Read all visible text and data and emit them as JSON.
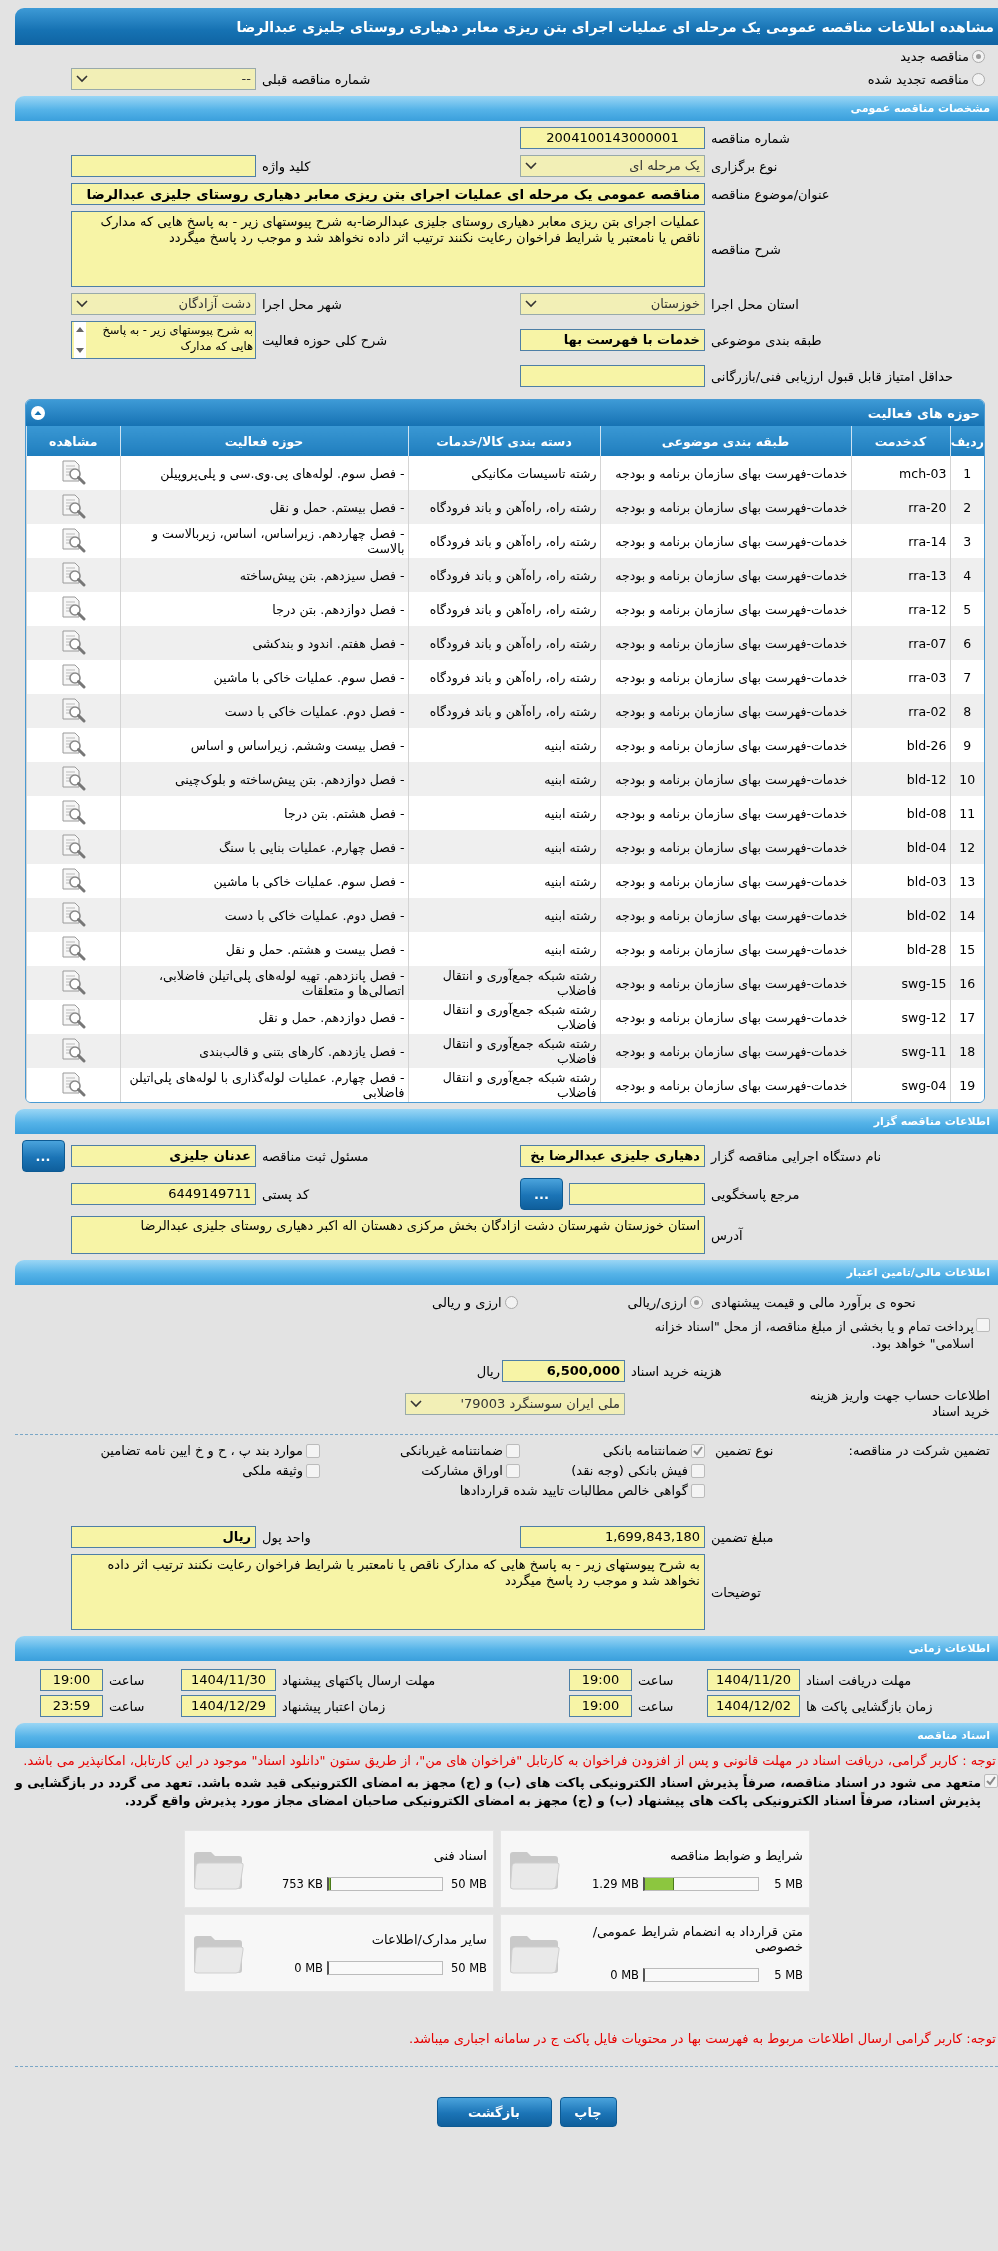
{
  "window": {
    "title": "مشاهده اطلاعات مناقصه عمومی یک مرحله ای عملیات اجرای بتن ریزی معابر دهیاری روستای جلیزی عبدالرضا"
  },
  "tender_type": {
    "options": [
      {
        "label": "مناقصه جدید",
        "selected": true
      },
      {
        "label": "مناقصه تجدید شده",
        "selected": false
      }
    ],
    "previous_tender": {
      "label": "شماره مناقصه قبلی",
      "kind": "select",
      "value": "--"
    }
  },
  "general": {
    "header": "مشخصات مناقصه عمومی",
    "rows": [
      [
        {
          "label": "شماره مناقصه",
          "kind": "id",
          "value": "2004100143000001"
        }
      ],
      [
        {
          "label": "نوع برگزاری",
          "kind": "select",
          "value": "یک مرحله ای"
        },
        {
          "label": "کلید واژه",
          "kind": "text"
        }
      ],
      [
        {
          "label": "عنوان/موضوع مناقصه",
          "kind": "title",
          "value": "مناقصه عمومی یک مرحله ای عملیات اجرای بتن ریزی معابر دهیاری روستای جلیزی عبدالرضا"
        }
      ],
      [
        {
          "label": "شرح مناقصه",
          "kind": "textarea",
          "value": "عملیات اجرای بتن ریزی معابر دهیاری روستای جلیزی عبدالرضا-به شرح پیوستهای زیر - به پاسخ هایی که مدارک ناقص یا نامعتبر یا شرایط فراخوان رعایت نکنند ترتیب اثر داده نخواهد شد و موجب رد پاسخ میگردد"
        }
      ],
      [
        {
          "label": "استان محل اجرا",
          "kind": "select",
          "value": "خوزستان"
        },
        {
          "label": "شهر محل اجرا",
          "kind": "select",
          "value": "دشت آزادگان"
        }
      ],
      [
        {
          "label": "طبقه بندی موضوعی",
          "kind": "text",
          "emphasis": true,
          "value": "خدمات با فهرست بها"
        },
        {
          "label": "شرح کلی حوزه فعالیت",
          "kind": "list",
          "value": "به شرح پیوستهای زیر - به پاسخ هایی که مدارک"
        }
      ],
      [
        {
          "label": "حداقل امتیاز قابل قبول ارزیابی فنی/بازرگانی",
          "kind": "text"
        }
      ]
    ]
  },
  "activities": {
    "header": "حوزه های فعالیت",
    "columns": [
      "ردیف",
      "کدخدمت",
      "طبقه بندی موضوعی",
      "دسته بندی کالا/خدمات",
      "حوزه فعالیت",
      "مشاهده"
    ],
    "rows": [
      [
        "1",
        "mch-03",
        "خدمات-فهرست بهای سازمان برنامه و بودجه",
        "رشته تاسیسات مکانیکی",
        "- فصل سوم. لوله‌های پی.وی.سی و پلی‌پروپیلن"
      ],
      [
        "2",
        "rra-20",
        "خدمات-فهرست بهای سازمان برنامه و بودجه",
        "رشته راه، راه‌آهن و باند فرودگاه",
        "- فصل بیستم. حمل و نقل"
      ],
      [
        "3",
        "rra-14",
        "خدمات-فهرست بهای سازمان برنامه و بودجه",
        "رشته راه، راه‌آهن و باند فرودگاه",
        "- فصل چهاردهم. زیراساس، اساس، زیربالاست و بالاست"
      ],
      [
        "4",
        "rra-13",
        "خدمات-فهرست بهای سازمان برنامه و بودجه",
        "رشته راه، راه‌آهن و باند فرودگاه",
        "- فصل سیزدهم. بتن پیش‌ساخته"
      ],
      [
        "5",
        "rra-12",
        "خدمات-فهرست بهای سازمان برنامه و بودجه",
        "رشته راه، راه‌آهن و باند فرودگاه",
        "- فصل دوازدهم. بتن درجا"
      ],
      [
        "6",
        "rra-07",
        "خدمات-فهرست بهای سازمان برنامه و بودجه",
        "رشته راه، راه‌آهن و باند فرودگاه",
        "- فصل هفتم. اندود و بندکشی"
      ],
      [
        "7",
        "rra-03",
        "خدمات-فهرست بهای سازمان برنامه و بودجه",
        "رشته راه، راه‌آهن و باند فرودگاه",
        "- فصل سوم. عملیات خاکی با ماشین"
      ],
      [
        "8",
        "rra-02",
        "خدمات-فهرست بهای سازمان برنامه و بودجه",
        "رشته راه، راه‌آهن و باند فرودگاه",
        "- فصل دوم. عملیات خاکی با دست"
      ],
      [
        "9",
        "bld-26",
        "خدمات-فهرست بهای سازمان برنامه و بودجه",
        "رشته ابنیه",
        "- فصل بیست وششم. زیراساس و اساس"
      ],
      [
        "10",
        "bld-12",
        "خدمات-فهرست بهای سازمان برنامه و بودجه",
        "رشته ابنیه",
        "- فصل دوازدهم. بتن پیش‌ساخته و بلوک‌چینی"
      ],
      [
        "11",
        "bld-08",
        "خدمات-فهرست بهای سازمان برنامه و بودجه",
        "رشته ابنیه",
        "- فصل هشتم. بتن درجا"
      ],
      [
        "12",
        "bld-04",
        "خدمات-فهرست بهای سازمان برنامه و بودجه",
        "رشته ابنیه",
        "- فصل چهارم. عملیات بنایی با سنگ"
      ],
      [
        "13",
        "bld-03",
        "خدمات-فهرست بهای سازمان برنامه و بودجه",
        "رشته ابنیه",
        "- فصل سوم. عملیات خاکی با ماشین"
      ],
      [
        "14",
        "bld-02",
        "خدمات-فهرست بهای سازمان برنامه و بودجه",
        "رشته ابنیه",
        "- فصل دوم. عملیات خاکی با دست"
      ],
      [
        "15",
        "bld-28",
        "خدمات-فهرست بهای سازمان برنامه و بودجه",
        "رشته ابنیه",
        "- فصل بیست و هشتم. حمل و نقل"
      ],
      [
        "16",
        "swg-15",
        "خدمات-فهرست بهای سازمان برنامه و بودجه",
        "رشته شبکه جمع‌آوری و انتقال فاضلاب",
        "- فصل پانزدهم. تهیه لوله‌های پلی‌اتیلن فاضلابی، اتصالی‌ها و متعلقات"
      ],
      [
        "17",
        "swg-12",
        "خدمات-فهرست بهای سازمان برنامه و بودجه",
        "رشته شبکه جمع‌آوری و انتقال فاضلاب",
        "- فصل دوازدهم. حمل و نقل"
      ],
      [
        "18",
        "swg-11",
        "خدمات-فهرست بهای سازمان برنامه و بودجه",
        "رشته شبکه جمع‌آوری و انتقال فاضلاب",
        "- فصل یازدهم. کارهای بتنی و قالب‌بندی"
      ],
      [
        "19",
        "swg-04",
        "خدمات-فهرست بهای سازمان برنامه و بودجه",
        "رشته شبکه جمع‌آوری و انتقال فاضلاب",
        "- فصل چهارم. عملیات لوله‌گذاری با لوله‌های پلی‌اتیلن فاضلابی"
      ]
    ]
  },
  "tenderer": {
    "header": "اطلاعات مناقصه گزار",
    "rows": [
      [
        {
          "label": "نام دستگاه اجرایی مناقصه گزار",
          "kind": "text",
          "emphasis": true,
          "value": "دهیاری جلیزی عبدالرضا بخ"
        },
        {
          "label": "مسئول ثبت مناقصه",
          "kind": "text",
          "emphasis": true,
          "value": "عدنان جلیزی",
          "button": "..."
        }
      ],
      [
        {
          "label": "مرجع پاسخگویی",
          "kind": "text",
          "button": "..."
        },
        {
          "label": "کد پستی",
          "kind": "text",
          "value": "6449149711"
        }
      ],
      [
        {
          "label": "آدرس",
          "kind": "address",
          "value": "استان خوزستان شهرستان دشت ازادگان بخش مرکزی دهستان اله اکبر دهیاری روستای جلیزی عبدالرضا"
        }
      ]
    ]
  },
  "finance": {
    "header": "اطلاعات مالی/تامین اعتبار",
    "estimate": {
      "label": "نحوه ی برآورد مالی و قیمت پیشنهادی",
      "options": [
        {
          "label": "ارزی/ریالی",
          "selected": true
        },
        {
          "label": "ارزی و ریالی",
          "selected": false
        }
      ]
    },
    "treasury": {
      "label": "پرداخت تمام و یا بخشی از مبلغ مناقصه، از محل \"اسناد خزانه اسلامی\" خواهد بود.",
      "checked": false
    },
    "fee": {
      "label": "هزینه خرید اسناد",
      "value": "6,500,000",
      "unit": "ریال"
    },
    "account": {
      "label": "اطلاعات حساب جهت واریز هزینه خرید اسناد",
      "value": "ملی ایران سوسنگرد 79003'"
    }
  },
  "guarantee": {
    "label": "تضمین شرکت در مناقصه:",
    "type_label": "نوع تضمین",
    "options": [
      {
        "label": "ضمانتنامه بانکی",
        "checked": true
      },
      {
        "label": "ضمانتنامه غیربانکی",
        "checked": false
      },
      {
        "label": "موارد بند پ ، ح و خ ایین نامه تضامین",
        "checked": false
      },
      {
        "label": "فیش بانکی (وجه نقد)",
        "checked": false
      },
      {
        "label": "اوراق مشارکت",
        "checked": false
      },
      {
        "label": "وثیقه ملکی",
        "checked": false
      },
      {
        "label": "گواهی خالص مطالبات تایید شده قراردادها",
        "checked": false
      }
    ],
    "rows": [
      [
        {
          "label": "مبلغ تضمین",
          "kind": "text",
          "value": "1,699,843,180"
        },
        {
          "label": "واحد پول",
          "kind": "text",
          "emphasis": true,
          "value": "ریال"
        }
      ],
      [
        {
          "label": "توضیحات",
          "kind": "textarea",
          "value": "به شرح پیوستهای زیر - به پاسخ هایی که مدارک ناقص یا نامعتبر یا شرایط فراخوان رعایت نکنند ترتیب اثر داده نخواهد شد و موجب رد پاسخ میگردد"
        }
      ]
    ]
  },
  "timing": {
    "header": "اطلاعات زمانی",
    "items": [
      {
        "label": "مهلت دریافت اسناد",
        "date": "1404/11/20",
        "time_label": "ساعت",
        "time": "19:00"
      },
      {
        "label": "مهلت ارسال پاکتهای پیشنهاد",
        "date": "1404/11/30",
        "time_label": "ساعت",
        "time": "19:00"
      },
      {
        "label": "زمان بازگشایی پاکت ها",
        "date": "1404/12/02",
        "time_label": "ساعت",
        "time": "19:00"
      },
      {
        "label": "زمان اعتبار پیشنهاد",
        "date": "1404/12/29",
        "time_label": "ساعت",
        "time": "23:59"
      }
    ]
  },
  "documents": {
    "header": "اسناد مناقصه",
    "notice": "توجه : کاربر گرامی، دریافت اسناد در مهلت قانونی و پس از افزودن فراخوان به کارتابل \"فراخوان های من\"، از طریق ستون \"دانلود اسناد\" موجود در این کارتابل، امکانپذیر می باشد.",
    "commitment": {
      "text": "متعهد می شود در اسناد مناقصه، صرفاً پذیرش اسناد الکترونیکی پاکت های (ب) و (ج) مجهز به امضای الکترونیکی قید شده باشد. تعهد می گردد در بازگشایی و پذیرش اسناد، صرفاً اسناد الکترونیکی پاکت های پیشنهاد (ب) و (ج) مجهز به امضای الکترونیکی صاحبان امضای مجاز مورد پذیرش واقع گردد.",
      "checked": true
    },
    "files": [
      {
        "title": "شرایط و ضوابط مناقصه",
        "size": "1.29 MB",
        "max": "5 MB",
        "level": 0.26
      },
      {
        "title": "اسناد فنی",
        "size": "753 KB",
        "max": "50 MB",
        "level": 0.015
      },
      {
        "title": "متن قرارداد به انضمام شرایط عمومی/خصوصی",
        "size": "0 MB",
        "max": "5 MB",
        "level": 0
      },
      {
        "title": "سایر مدارک/اطلاعات",
        "size": "0 MB",
        "max": "50 MB",
        "level": 0
      }
    ],
    "footer_notice": "توجه: کاربر گرامی ارسال اطلاعات مربوط به فهرست بها در محتویات فایل پاکت ج در سامانه اجباری میباشد."
  },
  "actions": [
    "چاپ",
    "بازگشت"
  ]
}
